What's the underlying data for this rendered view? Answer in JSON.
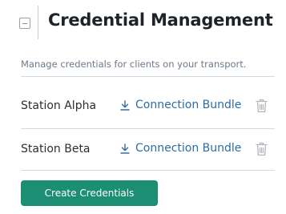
{
  "header": {
    "title": "Credential Management",
    "collapse_icon": "minus-square-icon"
  },
  "description": "Manage credentials for clients on your transport.",
  "credentials": [
    {
      "name": "Station Alpha",
      "link_label": "Connection Bundle",
      "link_icon": "download-icon",
      "delete_icon": "trash-icon"
    },
    {
      "name": "Station Beta",
      "link_label": "Connection Bundle",
      "link_icon": "download-icon",
      "delete_icon": "trash-icon"
    }
  ],
  "create_button_label": "Create Credentials",
  "colors": {
    "link": "#2e6da4",
    "primary_button": "#1b8e73",
    "title": "#1f2328",
    "muted_text": "#6b7a8a",
    "icon_gray": "#b0b4b9"
  }
}
